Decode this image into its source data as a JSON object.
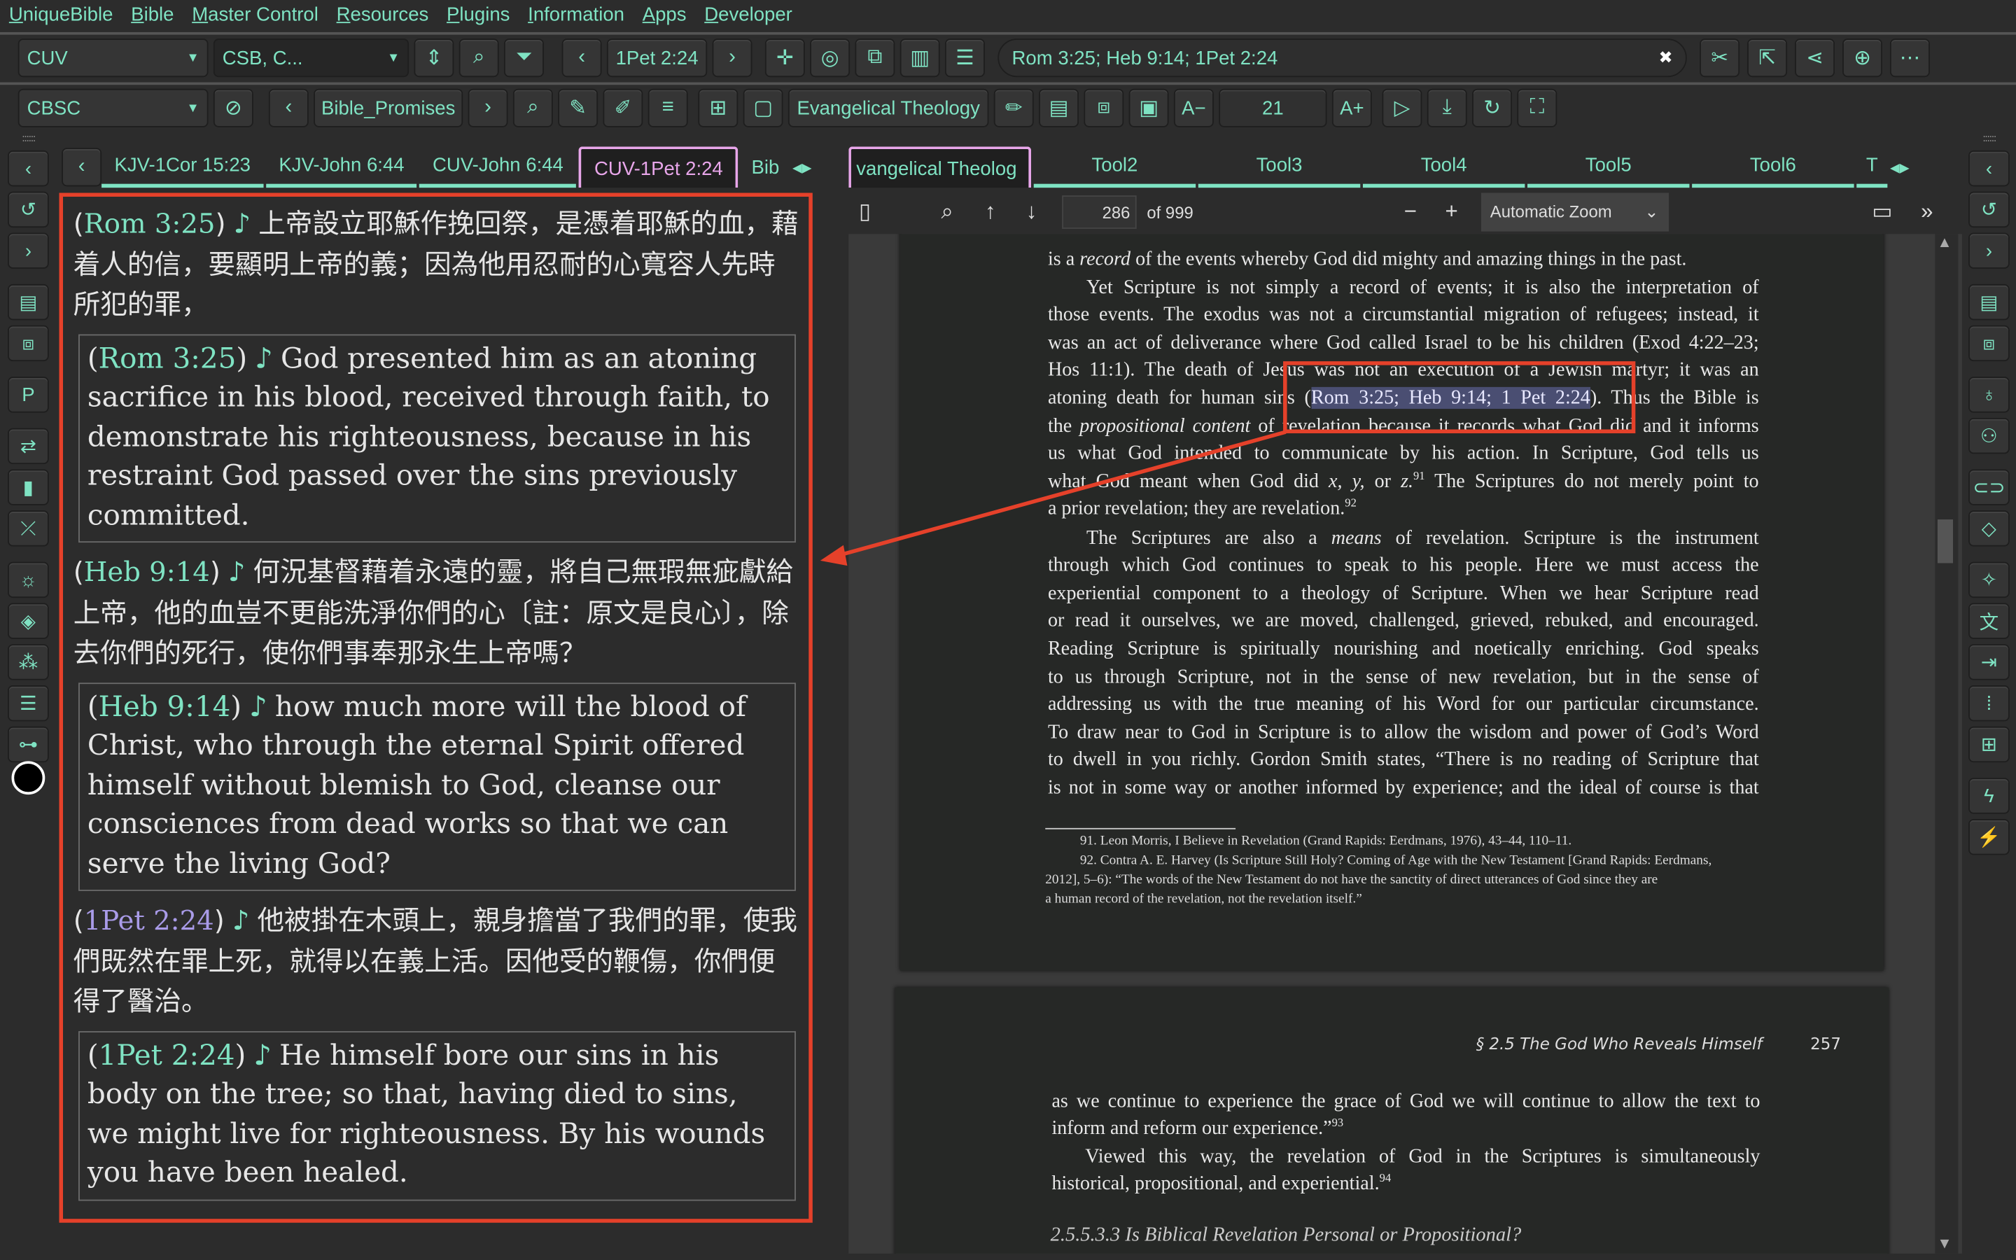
{
  "menu": [
    "UniqueBible",
    "Bible",
    "Master Control",
    "Resources",
    "Plugins",
    "Information",
    "Apps",
    "Developer"
  ],
  "toolbar1": {
    "bible": "CUV",
    "compare": "CSB, C...",
    "reference": "1Pet 2:24",
    "search_value": "Rom 3:25; Heb 9:14; 1Pet 2:24",
    "icons_a": [
      "sort-updown-icon",
      "search-icon",
      "filter-icon"
    ],
    "icons_b": [
      "crosshair-icon",
      "cursor-click-icon",
      "copy-windows-icon",
      "columns-icon",
      "list-icon"
    ],
    "icons_c": [
      "scissors-icon",
      "open-external-icon",
      "share-icon",
      "add-circle-icon",
      "more-icon"
    ]
  },
  "toolbar2": {
    "commentary": "CBSC",
    "topic": "Bible_Promises",
    "book": "Evangelical Theology",
    "font_size": "21",
    "font_dec": "A−",
    "font_inc": "A+",
    "icons_a": [
      "sync-off-icon"
    ],
    "icons_b": [
      "search-icon",
      "edit-note-icon",
      "highlighter-icon",
      "notes-list-icon"
    ],
    "icons_c": [
      "add-file-icon",
      "file-open-icon"
    ],
    "icons_d": [
      "pencil-icon",
      "document-icon",
      "pdf-icon",
      "save-as-icon"
    ],
    "icons_e": [
      "play-icon",
      "download-icon",
      "refresh-icon",
      "fullscreen-icon"
    ]
  },
  "left_tabs": [
    "KJV-1Cor 15:23",
    "KJV-John 6:44",
    "CUV-John 6:44",
    "CUV-1Pet 2:24",
    "Bib"
  ],
  "left_active_tab": 3,
  "right_tabs": [
    "vangelical Theolog",
    "Tool2",
    "Tool3",
    "Tool4",
    "Tool5",
    "Tool6",
    "T"
  ],
  "left_rail": [
    "chevron-left-icon",
    "history-icon",
    "chevron-right-icon",
    "document-icon",
    "pdf-icon",
    "p-icon",
    "swap-icon",
    "book-audio-icon",
    "no-link-icon",
    "brightness-icon",
    "layers-icon",
    "network-icon",
    "list-box-icon",
    "tree-icon"
  ],
  "right_rail": [
    "chevron-left-icon",
    "history-icon",
    "chevron-right-icon",
    "document-icon",
    "pdf-icon",
    "lightbulb-icon",
    "reader-icon",
    "link-icon",
    "diamond-icon",
    "sparkle-icon",
    "translate-icon",
    "align-right-icon",
    "dots-grid-icon",
    "widgets-icon",
    "flash-a-icon",
    "flash-icon"
  ],
  "verses": [
    {
      "ref": "Rom 3:25",
      "visited": false,
      "zh": "上帝設立耶穌作挽回祭，是憑着耶穌的血，藉着人的信，要顯明上帝的義；因為他用忍耐的心寬容人先時所犯的罪，",
      "en_ref": "Rom 3:25",
      "en": "God presented him as an atoning sacrifice in his blood, received through faith, to demonstrate his righteousness, because in his restraint God passed over the sins previously committed."
    },
    {
      "ref": "Heb 9:14",
      "visited": false,
      "zh": "何況基督藉着永遠的靈，將自己無瑕無疵獻給上帝，他的血豈不更能洗淨你們的心〔註：原文是良心〕，除去你們的死行，使你們事奉那永生上帝嗎？",
      "en_ref": "Heb 9:14",
      "en": "how much more will the blood of Christ, who through the eternal Spirit offered himself without blemish to God, cleanse our consciences from dead works so that we can serve the living God?"
    },
    {
      "ref": "1Pet 2:24",
      "visited": true,
      "zh": "他被掛在木頭上，親身擔當了我們的罪，使我們既然在罪上死，就得以在義上活。因他受的鞭傷，你們便得了醫治。",
      "en_ref": "1Pet 2:24",
      "en": "He himself bore our sins in his body on the tree; so that, having died to sins, we might live for righteousness. By his wounds you have been healed."
    }
  ],
  "pdf": {
    "page_number": "286",
    "page_count": "of 999",
    "zoom": "Automatic Zoom",
    "page1_lines": [
      {
        "cls": "last",
        "seg": [
          {
            "t": "is a "
          },
          {
            "t": "record",
            "i": true
          },
          {
            "t": " of the events whereby God did mighty and amazing things in the past."
          }
        ]
      },
      {
        "cls": "ind",
        "seg": [
          {
            "t": "Yet Scripture is not simply a record of events; it is also the interpretation of"
          }
        ]
      },
      {
        "seg": [
          {
            "t": "those events. The exodus was not a circumstantial migration of refugees; instead, it"
          }
        ]
      },
      {
        "seg": [
          {
            "t": "was an act of deliverance where God called Israel to be his children (Exod 4:22–23;"
          }
        ]
      },
      {
        "seg": [
          {
            "t": "Hos 11:1). The death of Jesus was not an execution of a Jewish martyr; it was an"
          }
        ]
      },
      {
        "seg": [
          {
            "t": "atoning death for human sins ("
          },
          {
            "t": "Rom 3:25; Heb 9:14; 1 Pet 2:24",
            "h": true
          },
          {
            "t": "). Thus the Bible is"
          }
        ]
      },
      {
        "seg": [
          {
            "t": "the "
          },
          {
            "t": "propositional content",
            "i": true
          },
          {
            "t": " of revelation because it records what God did and it informs"
          }
        ]
      },
      {
        "seg": [
          {
            "t": "us what God intended to communicate by his action. In Scripture, God tells us"
          }
        ]
      },
      {
        "seg": [
          {
            "t": "what God meant when God did "
          },
          {
            "t": "x, y,",
            "i": true
          },
          {
            "t": " or "
          },
          {
            "t": "z.",
            "i": true
          },
          {
            "t": "91",
            "s": true
          },
          {
            "t": " The Scriptures do not merely point to"
          }
        ]
      },
      {
        "cls": "last",
        "seg": [
          {
            "t": "a prior revelation; they are revelation."
          },
          {
            "t": "92",
            "s": true
          }
        ]
      },
      {
        "cls": "ind",
        "seg": [
          {
            "t": "The Scriptures are also a "
          },
          {
            "t": "means",
            "i": true
          },
          {
            "t": " of revelation. Scripture is the instrument"
          }
        ]
      },
      {
        "seg": [
          {
            "t": "through which God continues to speak to his people. Here we must access the"
          }
        ]
      },
      {
        "seg": [
          {
            "t": "experiential component to a theology of Scripture. When we hear Scripture read"
          }
        ]
      },
      {
        "seg": [
          {
            "t": "or read it ourselves, we are moved, challenged, grieved, rebuked, and encouraged."
          }
        ]
      },
      {
        "seg": [
          {
            "t": "Reading Scripture is spiritually nourishing and noetically enriching. God speaks"
          }
        ]
      },
      {
        "seg": [
          {
            "t": "to us through Scripture, not in the sense of new revelation, but in the sense of"
          }
        ]
      },
      {
        "seg": [
          {
            "t": "addressing us with the true meaning of his Word for our particular circumstance."
          }
        ]
      },
      {
        "seg": [
          {
            "t": "To draw near to God in Scripture is to allow the wisdom and power of God’s Word"
          }
        ]
      },
      {
        "seg": [
          {
            "t": "to dwell in you richly. Gordon Smith states, “There is no reading of Scripture that"
          }
        ]
      },
      {
        "seg": [
          {
            "t": "is not in some way or another informed by experience; and the ideal of course is that"
          }
        ]
      }
    ],
    "footnotes": [
      "91. Leon Morris, I Believe in Revelation (Grand Rapids: Eerdmans, 1976), 43–44, 110–11.",
      "92. Contra A. E. Harvey (Is Scripture Still Holy? Coming of Age with the New Testament [Grand Rapids: Eerdmans,",
      "2012], 5–6): “The words of the New Testament do not have the sanctity of direct utterances of God since they are",
      "a human record of the revelation, not the revelation itself.”"
    ],
    "page2_header": "§ 2.5 The God Who Reveals Himself",
    "page2_number": "257",
    "page2_lines": [
      {
        "seg": [
          {
            "t": "as we continue to experience the grace of God we will continue to allow the text to"
          }
        ]
      },
      {
        "cls": "last",
        "seg": [
          {
            "t": "inform and reform our experience.”"
          },
          {
            "t": "93",
            "s": true
          }
        ]
      },
      {
        "cls": "ind",
        "seg": [
          {
            "t": "Viewed this way, the revelation of God in the Scriptures is simultaneously"
          }
        ]
      },
      {
        "cls": "last",
        "seg": [
          {
            "t": "historical, propositional, and experiential."
          },
          {
            "t": "94",
            "s": true
          }
        ]
      }
    ],
    "page2_heading": "2.5.5.3.3 Is Biblical Revelation Personal or Propositional?"
  },
  "colors": {
    "accent": "#7fe3c3",
    "annotation_red": "#e5412a",
    "active_tab": "#e8a6ea",
    "visited_ref": "#a99be8",
    "background": "#2c2c2c"
  }
}
